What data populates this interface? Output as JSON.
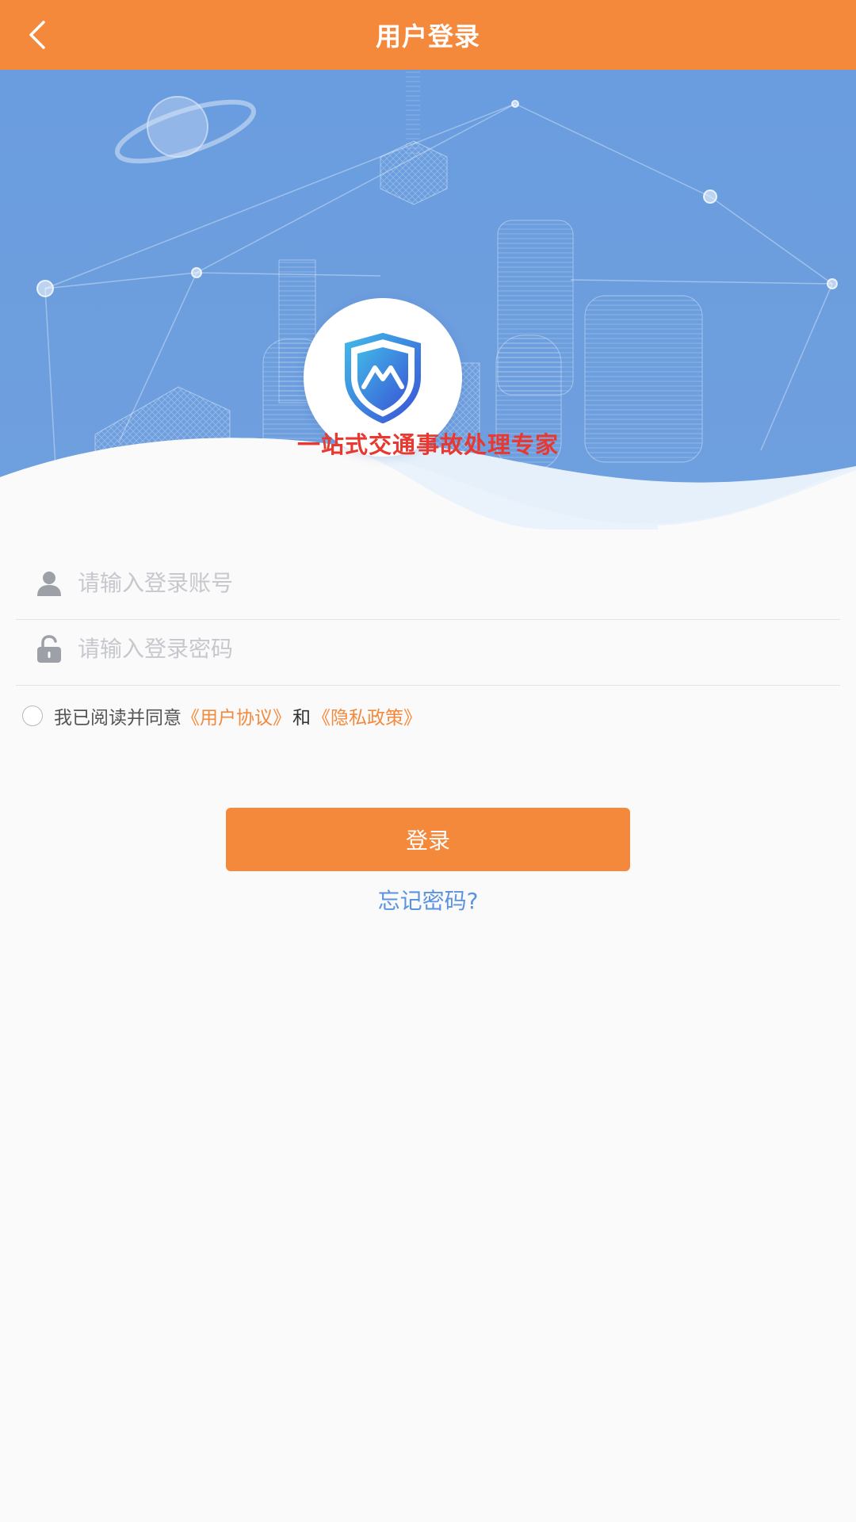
{
  "header": {
    "title": "用户登录",
    "back_icon": "chevron-left-icon"
  },
  "hero": {
    "slogan": "一站式交通事故处理专家",
    "logo_icon": "shield-mountain-logo"
  },
  "form": {
    "account": {
      "placeholder": "请输入登录账号",
      "icon": "user-icon",
      "value": ""
    },
    "password": {
      "placeholder": "请输入登录密码",
      "icon": "lock-icon",
      "value": ""
    },
    "agreement": {
      "checked": false,
      "prefix": "我已阅读并同意",
      "user_agreement": "《用户协议》",
      "and": "和",
      "privacy_policy": "《隐私政策》"
    },
    "login_label": "登录",
    "forgot_label": "忘记密码?"
  },
  "colors": {
    "primary": "#f4893c",
    "hero_blue": "#6a9ede",
    "slogan_red": "#e8382f",
    "link_blue": "#5a93de"
  }
}
